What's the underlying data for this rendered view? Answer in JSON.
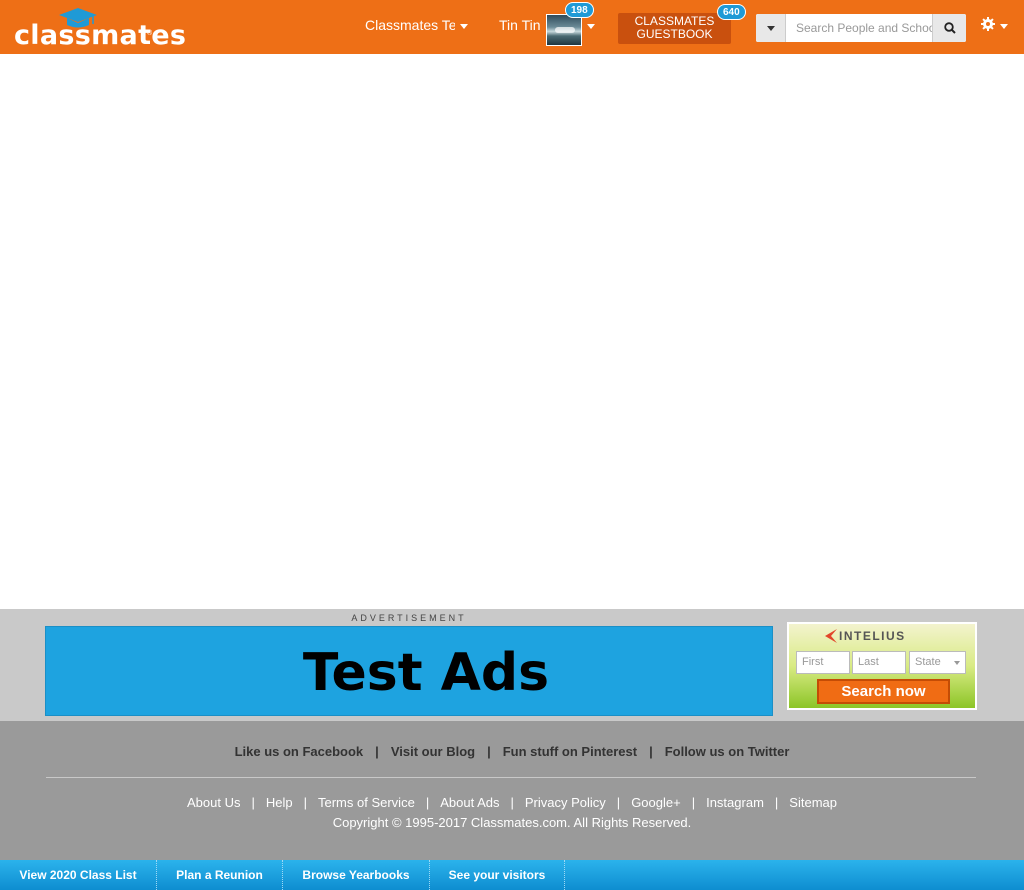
{
  "header": {
    "logo_text": "classmates",
    "logo_reg": "®",
    "nav_classmates": "Classmates Te",
    "nav_user": "Tin Tin",
    "profile_badge": "198",
    "guestbook_line1": "CLASSMATES",
    "guestbook_line2": "GUESTBOOK",
    "guestbook_badge": "640",
    "search_placeholder": "Search People and Schools",
    "icons": [
      "graduation-cap-icon",
      "caret-down-icon",
      "search-icon",
      "gear-icon"
    ]
  },
  "ad": {
    "label": "ADVERTISEMENT",
    "banner_text": "Test Ads",
    "intelius": {
      "brand": "INTELIUS",
      "first_placeholder": "First",
      "last_placeholder": "Last",
      "state_placeholder": "State",
      "button": "Search now"
    }
  },
  "footer": {
    "social": [
      "Like us on Facebook",
      "Visit our Blog",
      "Fun stuff on Pinterest",
      "Follow us on Twitter"
    ],
    "links": [
      "About Us",
      "Help",
      "Terms of Service",
      "About Ads",
      "Privacy Policy",
      "Google+",
      "Instagram",
      "Sitemap"
    ],
    "copyright": "Copyright © 1995-2017 Classmates.com. All Rights Reserved."
  },
  "bottom_bar": [
    "View 2020 Class List",
    "Plan a Reunion",
    "Browse Yearbooks",
    "See your visitors"
  ],
  "colors": {
    "header_orange": "#ee6f16",
    "guestbook_bg": "#c9500e",
    "badge_blue": "#1f9ad6",
    "ad_blue": "#1ea3e0",
    "footer_gray": "#9a9a9a",
    "bottom_bar_blue": "#0e8dd0"
  }
}
